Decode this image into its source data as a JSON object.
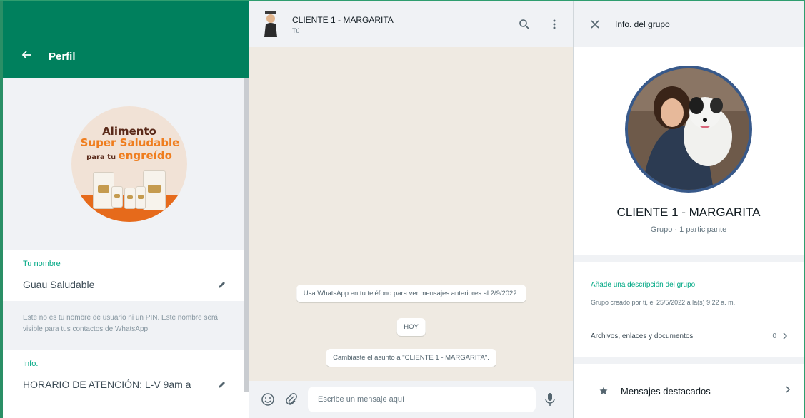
{
  "profile_panel": {
    "title": "Perfil",
    "promo": {
      "line1": "Alimento",
      "line2": "Super Saludable",
      "line3_prefix": "para tu",
      "line3_highlight": "engreído"
    },
    "name_label": "Tu nombre",
    "name_value": "Guau Saludable",
    "name_hint": "Este no es tu nombre de usuario ni un PIN. Este nombre será visible para tus contactos de WhatsApp.",
    "info_label": "Info.",
    "info_value": "HORARIO DE ATENCIÓN: L-V 9am a"
  },
  "chat": {
    "title": "CLIENTE 1 - MARGARITA",
    "subtitle": "Tú",
    "system_messages": [
      "Usa WhatsApp en tu teléfono para ver mensajes anteriores al 2/9/2022.",
      "HOY",
      "Cambiaste el asunto a \"CLIENTE 1 - MARGARITA\"."
    ],
    "composer_placeholder": "Escribe un mensaje aquí"
  },
  "group_info": {
    "title": "Info. del grupo",
    "group_name": "CLIENTE 1 - MARGARITA",
    "group_meta": "Grupo · 1 participante",
    "add_description": "Añade una descripción del grupo",
    "created": "Grupo creado por ti, el 25/5/2022 a la(s) 9:22 a. m.",
    "files_label": "Archivos, enlaces y documentos",
    "files_count": "0",
    "starred_label": "Mensajes destacados"
  },
  "colors": {
    "header_green": "#00805d",
    "accent": "#00a884",
    "chat_bg": "#efeae2",
    "panel_bg": "#f0f2f5"
  }
}
